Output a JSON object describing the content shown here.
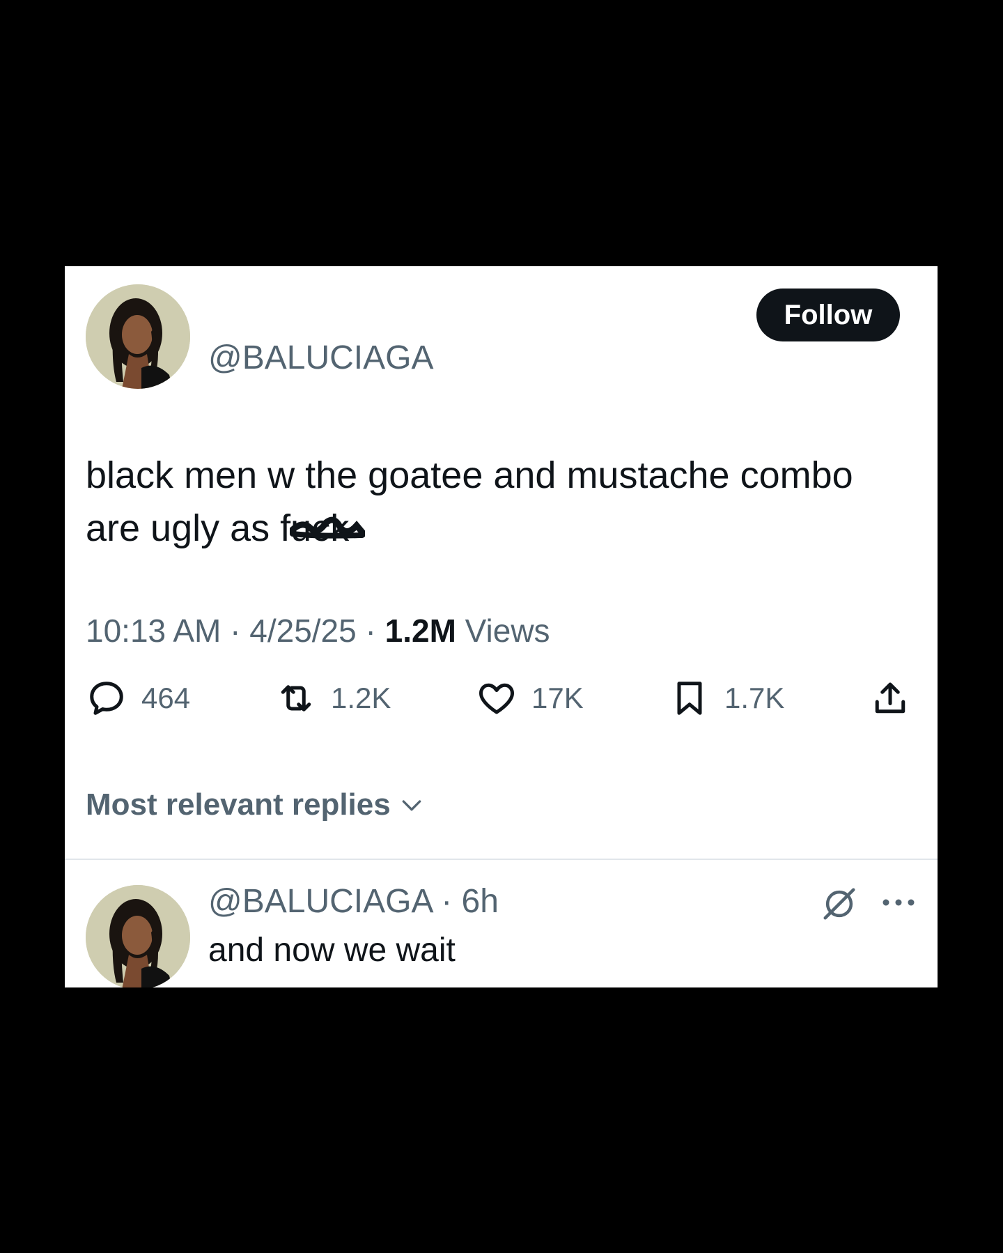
{
  "tweet": {
    "handle": "@BALUCIAGA",
    "follow_label": "Follow",
    "text_line1": "black men w the goatee and mustache combo",
    "text_line2_start": "are ugly as ",
    "text_line2_censored": "fuck",
    "time": "10:13 AM",
    "date": "4/25/25",
    "views_count": "1.2M",
    "views_label": "Views",
    "separator": "·"
  },
  "actions": {
    "replies": "464",
    "reposts": "1.2K",
    "likes": "17K",
    "bookmarks": "1.7K"
  },
  "replies_filter": {
    "label": "Most relevant replies"
  },
  "reply": {
    "handle": "@BALUCIAGA",
    "age": "6h",
    "text": "and now we wait"
  },
  "icons": {
    "reply": "speech-bubble-icon",
    "repost": "repost-arrows-icon",
    "like": "heart-icon",
    "bookmark": "bookmark-icon",
    "share": "share-upload-icon",
    "grok": "grok-icon",
    "more": "more-dots-icon",
    "chevron": "chevron-down-icon"
  },
  "colors": {
    "page_background": "#000000",
    "card_background": "#ffffff",
    "primary_text": "#0f1419",
    "secondary_text": "#536471",
    "follow_button": "#0f1419"
  }
}
